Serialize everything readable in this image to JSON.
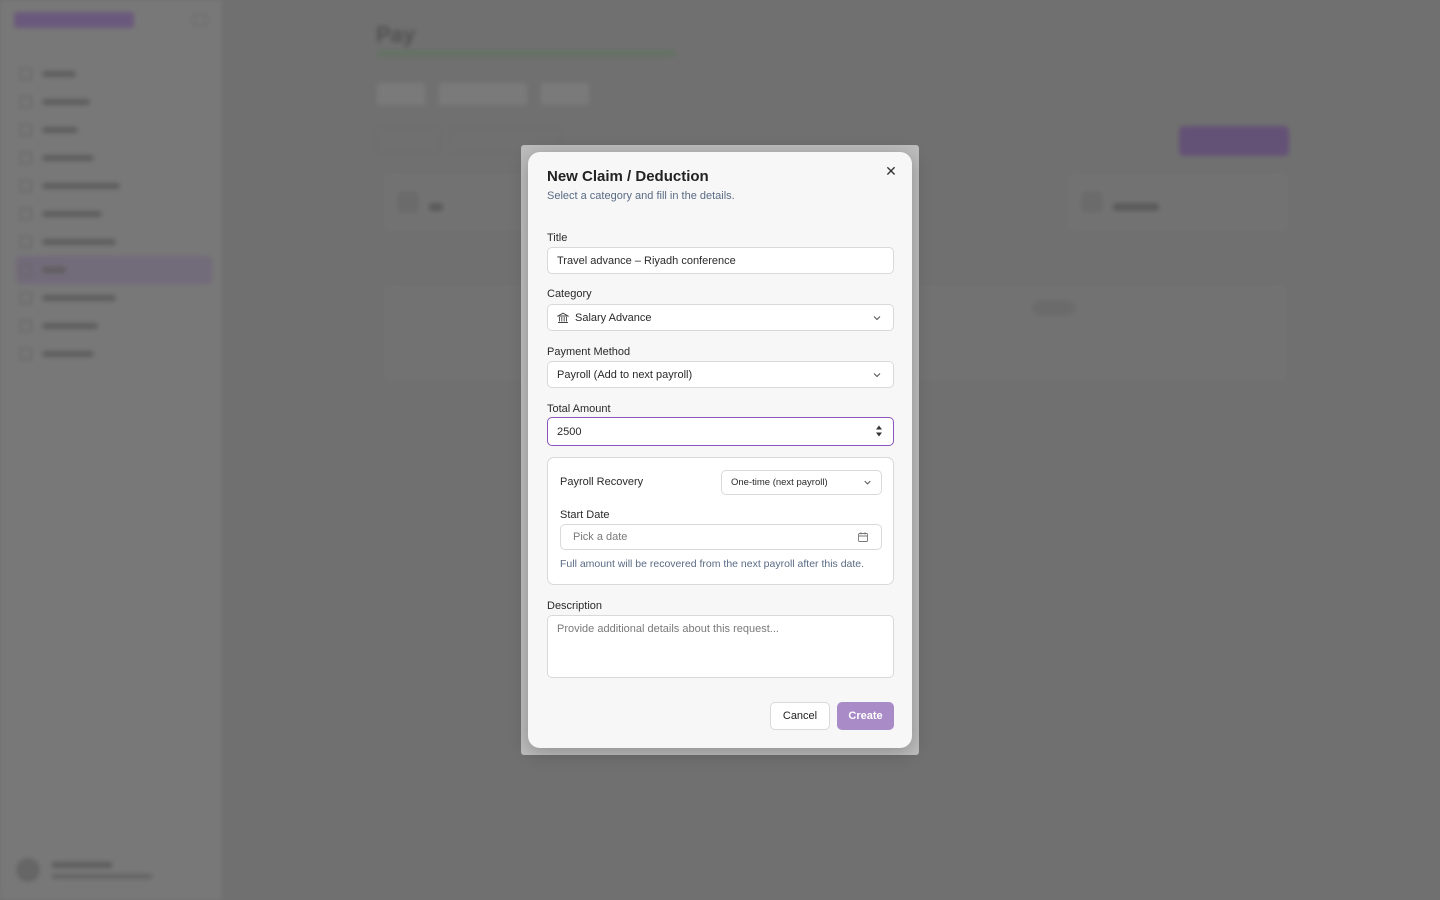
{
  "background": {
    "page_title": "Pay"
  },
  "modal": {
    "title": "New Claim / Deduction",
    "subtitle": "Select a category and fill in the details.",
    "close_icon": "close-icon",
    "fields": {
      "title": {
        "label": "Title",
        "value": "Travel advance – Riyadh conference"
      },
      "category": {
        "label": "Category",
        "value": "Salary Advance",
        "icon": "bank-icon"
      },
      "payment_method": {
        "label": "Payment Method",
        "value": "Payroll (Add to next payroll)"
      },
      "total_amount": {
        "label": "Total Amount",
        "value": "2500"
      }
    },
    "recovery": {
      "label": "Payroll Recovery",
      "value": "One-time (next payroll)",
      "start_date_label": "Start Date",
      "start_date_placeholder": "Pick a date",
      "help": "Full amount will be recovered from the next payroll after this date."
    },
    "description": {
      "label": "Description",
      "placeholder": "Provide additional details about this request..."
    },
    "buttons": {
      "cancel": "Cancel",
      "create": "Create"
    }
  },
  "colors": {
    "accent": "#8a55bd",
    "create_button": "#a98bc7",
    "muted_text": "#5a6b84"
  }
}
